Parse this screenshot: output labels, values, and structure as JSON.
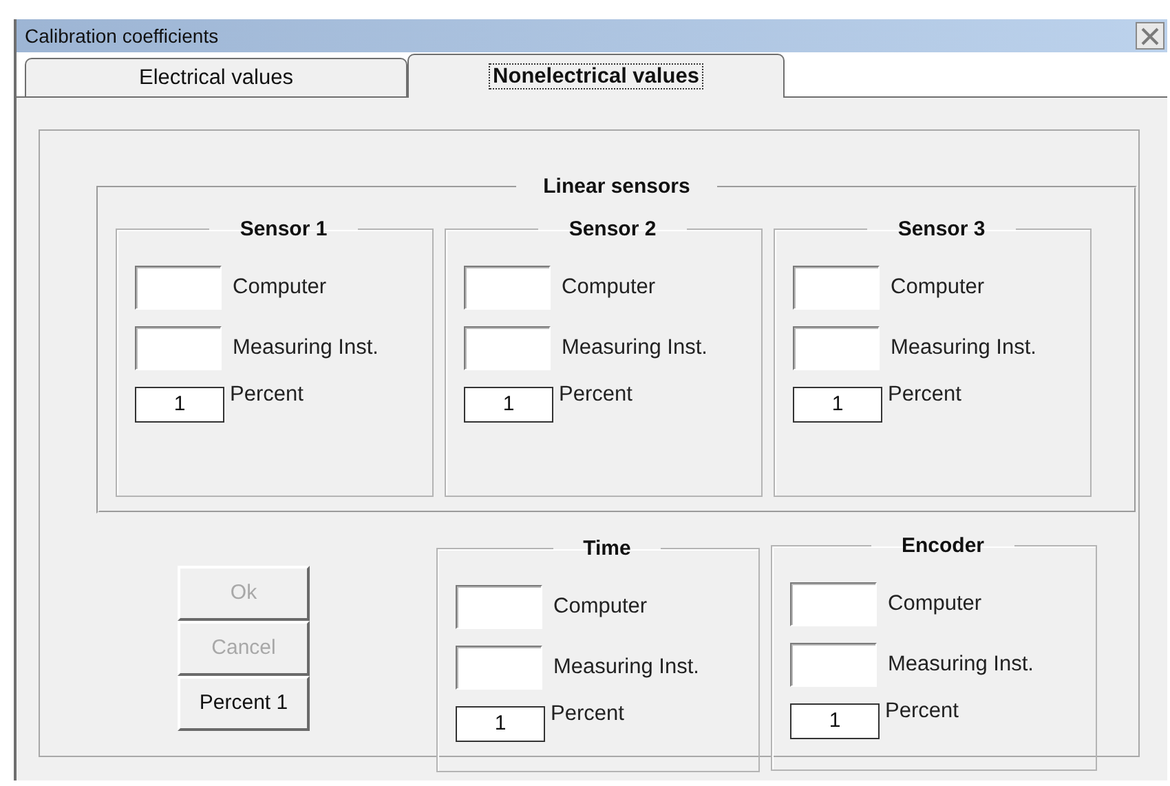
{
  "window": {
    "title": "Calibration coefficients"
  },
  "tabs": [
    {
      "label": "Electrical values",
      "selected": false
    },
    {
      "label": "Nonelectrical values",
      "selected": true
    }
  ],
  "linear_sensors": {
    "title": "Linear sensors",
    "sensors": [
      {
        "title": "Sensor 1",
        "fields": [
          {
            "kind": "blank",
            "label": "Computer"
          },
          {
            "kind": "blank",
            "label": "Measuring Inst."
          },
          {
            "kind": "value",
            "value": "1",
            "label": "Percent"
          }
        ]
      },
      {
        "title": "Sensor 2",
        "fields": [
          {
            "kind": "blank",
            "label": "Computer"
          },
          {
            "kind": "blank",
            "label": "Measuring Inst."
          },
          {
            "kind": "value",
            "value": "1",
            "label": "Percent"
          }
        ]
      },
      {
        "title": "Sensor 3",
        "fields": [
          {
            "kind": "blank",
            "label": "Computer"
          },
          {
            "kind": "blank",
            "label": "Measuring Inst."
          },
          {
            "kind": "value",
            "value": "1",
            "label": "Percent"
          }
        ]
      }
    ]
  },
  "buttons": [
    {
      "label": "Ok",
      "disabled": true
    },
    {
      "label": "Cancel",
      "disabled": true
    },
    {
      "label": "Percent 1",
      "disabled": false
    }
  ],
  "other_groups": [
    {
      "title": "Time",
      "fields": [
        {
          "kind": "blank",
          "label": "Computer"
        },
        {
          "kind": "blank",
          "label": "Measuring Inst."
        },
        {
          "kind": "value",
          "value": "1",
          "label": "Percent"
        }
      ]
    },
    {
      "title": "Encoder",
      "fields": [
        {
          "kind": "blank",
          "label": "Computer"
        },
        {
          "kind": "blank",
          "label": "Measuring Inst."
        },
        {
          "kind": "value",
          "value": "1",
          "label": "Percent"
        }
      ]
    }
  ]
}
